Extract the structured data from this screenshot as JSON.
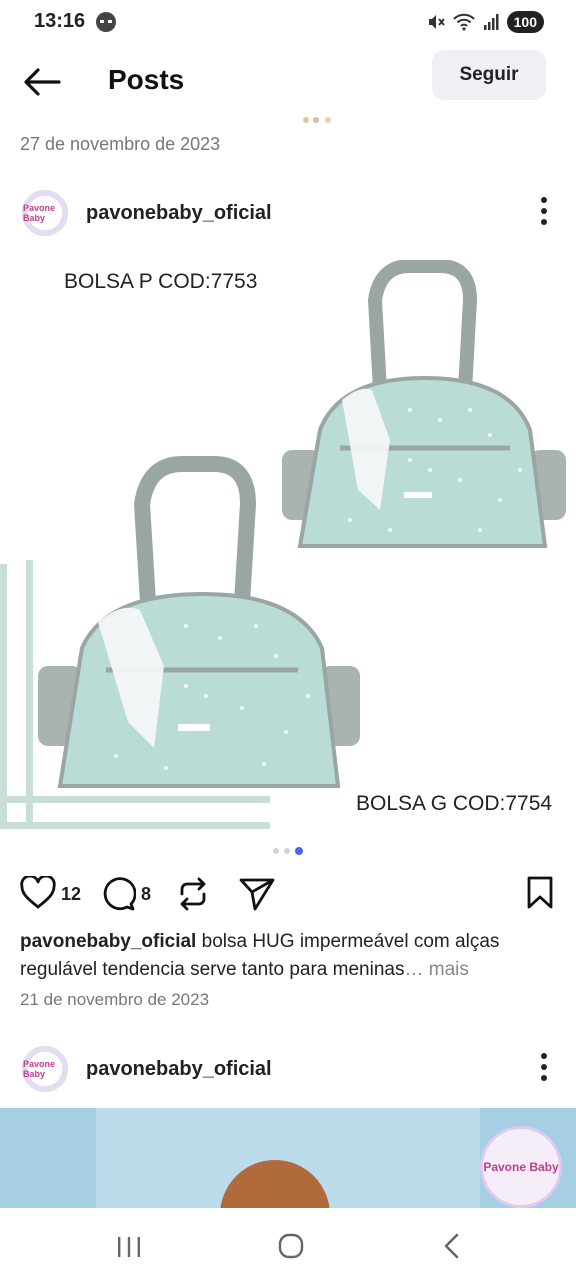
{
  "status_bar": {
    "time": "13:16",
    "battery": "100"
  },
  "app_bar": {
    "title": "Posts",
    "follow_label": "Seguir"
  },
  "previous_post": {
    "date": "27 de novembro de 2023"
  },
  "post": {
    "username": "pavonebaby_oficial",
    "avatar_text": "Pavone Baby",
    "image_labels": {
      "top": "BOLSA P COD:7753",
      "bottom": "BOLSA G COD:7754"
    },
    "carousel": {
      "count": 3,
      "active_index": 2
    },
    "likes": "12",
    "comments": "8",
    "caption_user": "pavonebaby_oficial",
    "caption_text": " bolsa HUG impermeável com alças regulável tendencia serve tanto para meninas",
    "caption_more": "… mais",
    "date": "21 de novembro de 2023"
  },
  "next_post": {
    "username": "pavonebaby_oficial",
    "avatar_text": "Pavone Baby",
    "watermark": "Pavone Baby"
  },
  "colors": {
    "bag_mint": "#b9dcd6",
    "bag_gray": "#9aa6a3",
    "accent_dot": "#4a63e8",
    "next_post_bg": "#a6cfe4"
  },
  "icons": {
    "back": "arrow-left-icon",
    "more": "vertical-dots-icon",
    "like": "heart-icon",
    "comment": "speech-bubble-icon",
    "repost": "repost-icon",
    "share": "paper-plane-icon",
    "save": "bookmark-icon"
  }
}
